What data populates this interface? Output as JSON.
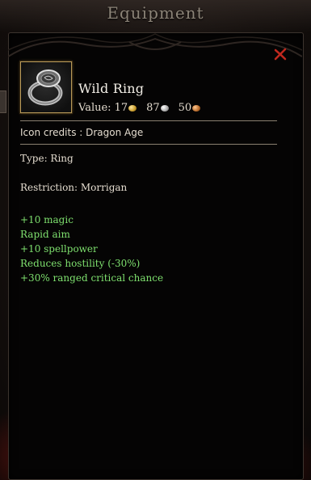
{
  "window": {
    "title": "Equipment"
  },
  "item": {
    "icon": "ring-icon",
    "name": "Wild Ring",
    "value_label": "Value:",
    "value": {
      "gold": "17",
      "silver": "87",
      "copper": "50"
    },
    "icon_credits": "Icon credits : Dragon Age",
    "type": "Type: Ring",
    "restriction": "Restriction: Morrigan",
    "stats": [
      "+10 magic",
      "Rapid aim",
      "+10 spellpower",
      "Reduces hostility (-30%)",
      "+30% ranged critical chance"
    ]
  },
  "colors": {
    "stat_text": "#7ee06e",
    "close_icon": "#c0281e",
    "frame_border": "#b89a5a"
  }
}
